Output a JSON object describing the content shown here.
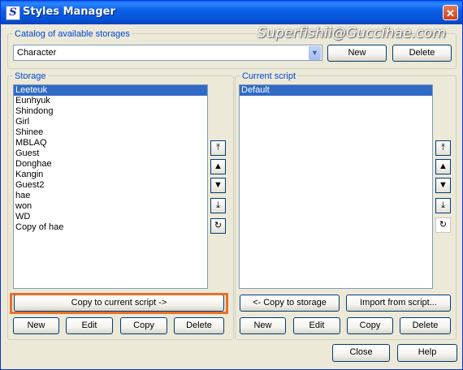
{
  "window": {
    "title": "Styles Manager",
    "app_icon_glyph": "S",
    "close_glyph": "✕"
  },
  "watermark": "Superfishii@Guccihae.com",
  "catalog": {
    "legend": "Catalog of available storages",
    "selected": "Character",
    "new_label": "New",
    "delete_label": "Delete"
  },
  "storage": {
    "legend": "Storage",
    "items": [
      "Leeteuk",
      "Eunhyuk",
      "Shindong",
      "Girl",
      "Shinee",
      "MBLAQ",
      "Guest",
      "Donghae",
      "Kangin",
      "Guest2",
      "hae",
      "won",
      "WD",
      "Copy of hae"
    ],
    "selected_index": 0,
    "copy_to_script_label": "Copy to current script ->",
    "new_label": "New",
    "edit_label": "Edit",
    "copy_label": "Copy",
    "delete_label": "Delete"
  },
  "current_script": {
    "legend": "Current script",
    "items": [
      "Default"
    ],
    "selected_index": 0,
    "copy_to_storage_label": "<- Copy to storage",
    "import_label": "Import from script...",
    "new_label": "New",
    "edit_label": "Edit",
    "copy_label": "Copy",
    "delete_label": "Delete"
  },
  "move_buttons": {
    "top": "⤒",
    "up": "▲",
    "down": "▼",
    "bottom": "⤓",
    "refresh": "↻"
  },
  "footer": {
    "close_label": "Close",
    "help_label": "Help"
  },
  "colors": {
    "title_blue": "#0a5fe6",
    "legend_blue": "#0046d5",
    "selection": "#316ac5",
    "highlight": "#e8702a"
  }
}
